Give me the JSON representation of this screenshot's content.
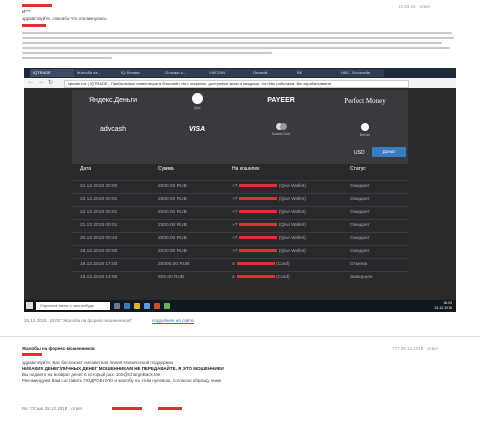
{
  "post1": {
    "author": "И***",
    "meta": "12.03.19  ·  ответ",
    "greeting": "здравствуйте, спасибо что откликнулись",
    "shot_caption": "26.12.2018, 18:00  \"Жалоба на форекс-мошенников\"",
    "caption_link": "подробнее на сайте"
  },
  "browser": {
    "tabs": [
      "IQTRADE",
      "Жалоба на...",
      "IQ Финанс",
      "Отзывы о...",
      "VMCOIN",
      "Личный...",
      "ВК",
      "НКБ - Блокчейн"
    ],
    "url": "iqtrade.biz  | IQTRADE - Прибыльные инвестиции в блокчейн <br> опционы, доступные всем и каждому. <br>Мы работаем. Вы зарабатываете"
  },
  "payments": [
    "Яндекс.Деньги",
    "Qiwi",
    "PAYEER",
    "Perfect Money",
    "advcash",
    "VISA",
    "MasterCard",
    "Bitcoin"
  ],
  "currency": "USD",
  "donate_button": "Донат",
  "table": {
    "headers": [
      "Дата",
      "Сумма",
      "На кошелек",
      "Статус"
    ],
    "rows": [
      {
        "date": "24.12.2018 20:00",
        "amount": "2500.00 RUB",
        "wallet": "(Qiwi Wallet)",
        "status": "Ожидает"
      },
      {
        "date": "23.12.2018 00:01",
        "amount": "2500.00 RUB",
        "wallet": "(Qiwi Wallet)",
        "status": "Ожидает"
      },
      {
        "date": "22.12.2018 00:01",
        "amount": "2500.00 RUB",
        "wallet": "(Qiwi Wallet)",
        "status": "Ожидает"
      },
      {
        "date": "21.12.2018 00:01",
        "amount": "2500.00 RUB",
        "wallet": "(Qiwi Wallet)",
        "status": "Ожидает"
      },
      {
        "date": "20.12.2018 00:43",
        "amount": "2500.00 RUB",
        "wallet": "(Qiwi Wallet)",
        "status": "Ожидает"
      },
      {
        "date": "19.12.2018 00:00",
        "amount": "2500.00 RUB",
        "wallet": "(Qiwi Wallet)",
        "status": "Ожидает"
      },
      {
        "date": "18.12.2018 17:03",
        "amount": "25000.00 RUB",
        "wallet": "(Card)",
        "status": "Отмена"
      },
      {
        "date": "18.12.2018 14:50",
        "amount": "500.00 RUB",
        "wallet": "(Card)",
        "status": "Завершен"
      }
    ]
  },
  "taskbar": {
    "search": "Спросите меня о чем-нибудь",
    "time": "18:03",
    "date": "24.12.2018"
  },
  "post2": {
    "title": "Жалобы на форекс-мошенников",
    "meta": "??? 28.12.2018  ·  ответ",
    "lines": [
      "здравствуйте. Вас беспокоит «иловетная линия технической поддержки",
      "НИКАКИХ ДЕНЕГ/ЛИЧНЫХ ДЕНЕГ МОШЕННИКАМ НЕ ПЕРЕДАВАЙТЕ, Я ЭТО МОШЕННИКИ",
      "Вы подаете на возврат денег в который раз: 100@ChargeBack.Me",
      "Рекомендуем Вам составить ПОДРОБНУЮ и жалобу на этим нулевою, согласно образцу ниже"
    ],
    "footer": "Re: Отзыв  28.12.2018  ·  ответ"
  },
  "colors": {
    "accent_red": "#e03030",
    "button_blue": "#3a7cc2",
    "page_bg": "#2a2a2c"
  }
}
